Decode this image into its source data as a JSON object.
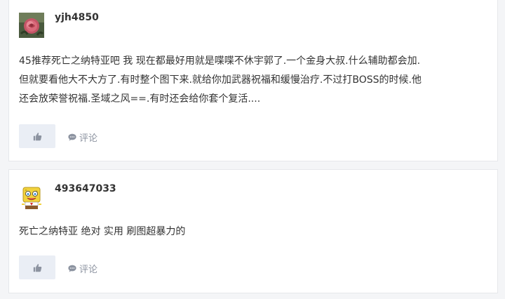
{
  "posts": [
    {
      "username": "yjh4850",
      "avatar_icon": "rose-flower-avatar",
      "content_lines": [
        "45推荐死亡之纳特亚吧 我 现在都最好用就是喋喋不休宇郭了.一个金身大叔.什么辅助都会加.",
        "但就要看他大不大方了.有时整个图下来.就给你加武器祝福和缓慢治疗.不过打BOSS的时候.他",
        "还会放荣誉祝福.圣域之风==.有时还会给你套个复活...."
      ],
      "like_icon": "thumbs-up-icon",
      "comment_label": "评论"
    },
    {
      "username": "493647033",
      "avatar_icon": "cartoon-sponge-avatar",
      "content_lines": [
        "死亡之纳特亚 绝对 实用 刷图超暴力的"
      ],
      "like_icon": "thumbs-up-icon",
      "comment_label": "评论"
    }
  ],
  "colors": {
    "page_bg": "#f4f5f7",
    "card_bg": "#ffffff",
    "text": "#333333",
    "muted": "#8c93a0",
    "like_bg": "#eaeef5"
  }
}
